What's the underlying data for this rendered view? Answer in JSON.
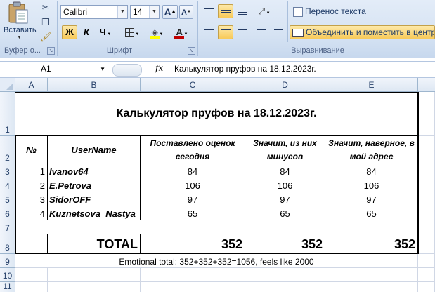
{
  "ribbon": {
    "clipboard": {
      "paste_label": "Вставить",
      "group_label": "Буфер о...",
      "cut_icon": "scissors-icon",
      "copy_icon": "copy-icon",
      "format_painter_icon": "brush-icon"
    },
    "font": {
      "font_name": "Calibri",
      "font_size": "14",
      "grow_label": "A",
      "shrink_label": "A",
      "bold_label": "Ж",
      "italic_label": "К",
      "underline_label": "Ч",
      "group_label": "Шрифт",
      "fill_color": "#ffff00",
      "font_color": "#c00000"
    },
    "alignment": {
      "wrap_text_label": "Перенос текста",
      "merge_label": "Объединить и поместить в центре",
      "group_label": "Выравнивание"
    }
  },
  "formula_bar": {
    "name_box": "A1",
    "fx_label": "fx",
    "content": "Калькулятор пруфов на 18.12.2023г."
  },
  "columns": [
    "A",
    "B",
    "C",
    "D",
    "E"
  ],
  "rows": [
    "1",
    "2",
    "3",
    "4",
    "5",
    "6",
    "7",
    "8",
    "9",
    "10",
    "11"
  ],
  "sheet": {
    "title": "Калькулятор пруфов на 18.12.2023г.",
    "headers": {
      "no": "№",
      "user": "UserName",
      "c": "Поставлено оценок сегодня",
      "d": "Значит, из них минусов",
      "e": "Значит, наверное, в мой адрес"
    },
    "data_rows": [
      {
        "no": "1",
        "user": "Ivanov64",
        "c": "84",
        "d": "84",
        "e": "84"
      },
      {
        "no": "2",
        "user": "E.Petrova",
        "c": "106",
        "d": "106",
        "e": "106"
      },
      {
        "no": "3",
        "user": "SidorOFF",
        "c": "97",
        "d": "97",
        "e": "97"
      },
      {
        "no": "4",
        "user": "Kuznetsova_Nastya",
        "c": "65",
        "d": "65",
        "e": "65"
      }
    ],
    "total_label": "TOTAL",
    "total_c": "352",
    "total_d": "352",
    "total_e": "352",
    "note": "Emotional total: 352+352+352=1056, feels like 2000"
  }
}
